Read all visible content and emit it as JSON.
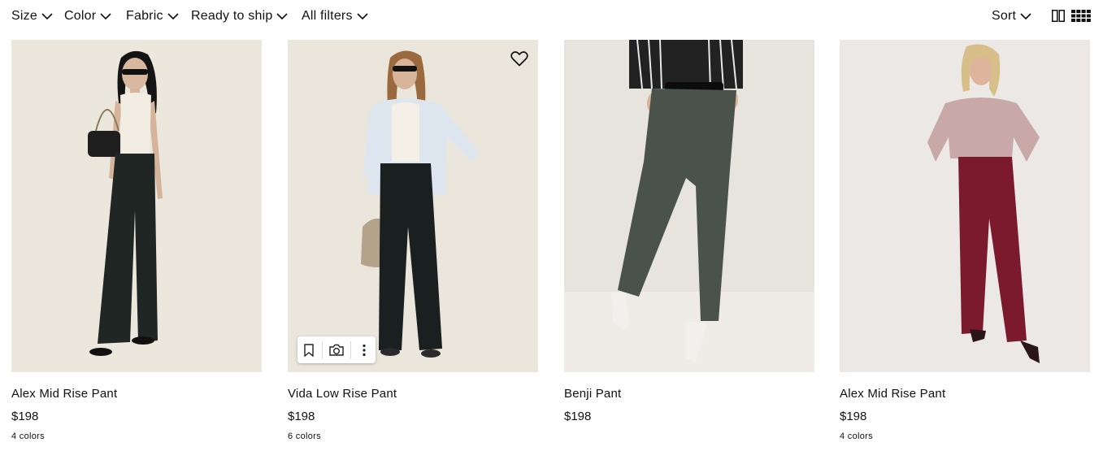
{
  "filters": {
    "size": "Size",
    "color": "Color",
    "fabric": "Fabric",
    "ready_to_ship": "Ready to ship",
    "all_filters": "All filters",
    "sort": "Sort"
  },
  "view_icons": [
    "two-column-grid-icon",
    "four-column-grid-icon"
  ],
  "products": [
    {
      "name": "Alex Mid Rise Pant",
      "price": "$198",
      "colors": "4 colors",
      "pant_color": "#1f2624"
    },
    {
      "name": "Vida Low Rise Pant",
      "price": "$198",
      "colors": "6 colors",
      "pant_color": "#1a1f20"
    },
    {
      "name": "Benji Pant",
      "price": "$198",
      "colors": "",
      "pant_color": "#4a524c"
    },
    {
      "name": "Alex Mid Rise Pant",
      "price": "$198",
      "colors": "4 colors",
      "pant_color": "#7a1a2c"
    }
  ],
  "hover_card_icons": [
    "heart-icon",
    "bookmark-icon",
    "camera-search-icon",
    "more-vertical-icon"
  ]
}
